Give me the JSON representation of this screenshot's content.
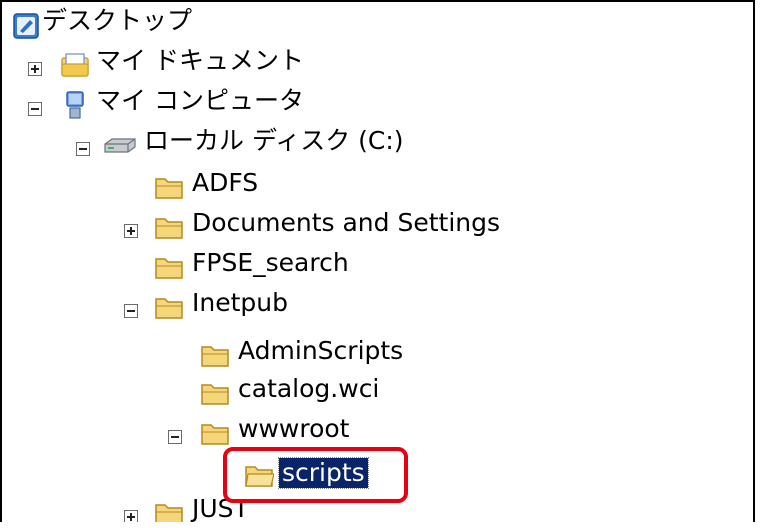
{
  "tree": {
    "desktop": "デスクトップ",
    "my_documents": "マイ ドキュメント",
    "my_computer": "マイ コンピュータ",
    "local_disk": "ローカル ディスク (C:)",
    "adfs": "ADFS",
    "documents_and_settings": "Documents and Settings",
    "fpse_search": "FPSE_search",
    "inetpub": "Inetpub",
    "adminscripts": "AdminScripts",
    "catalog_wci": "catalog.wci",
    "wwwroot": "wwwroot",
    "scripts": "scripts",
    "just": "JUST"
  },
  "colors": {
    "folder": "#f5d67a",
    "folder_dark": "#c9a13a",
    "selection": "#0a246a",
    "highlight_border": "#e60012"
  },
  "icons": {
    "desktop": "desktop-icon",
    "documents": "my-documents-icon",
    "computer": "my-computer-icon",
    "disk": "hard-disk-icon",
    "folder": "folder-icon"
  }
}
